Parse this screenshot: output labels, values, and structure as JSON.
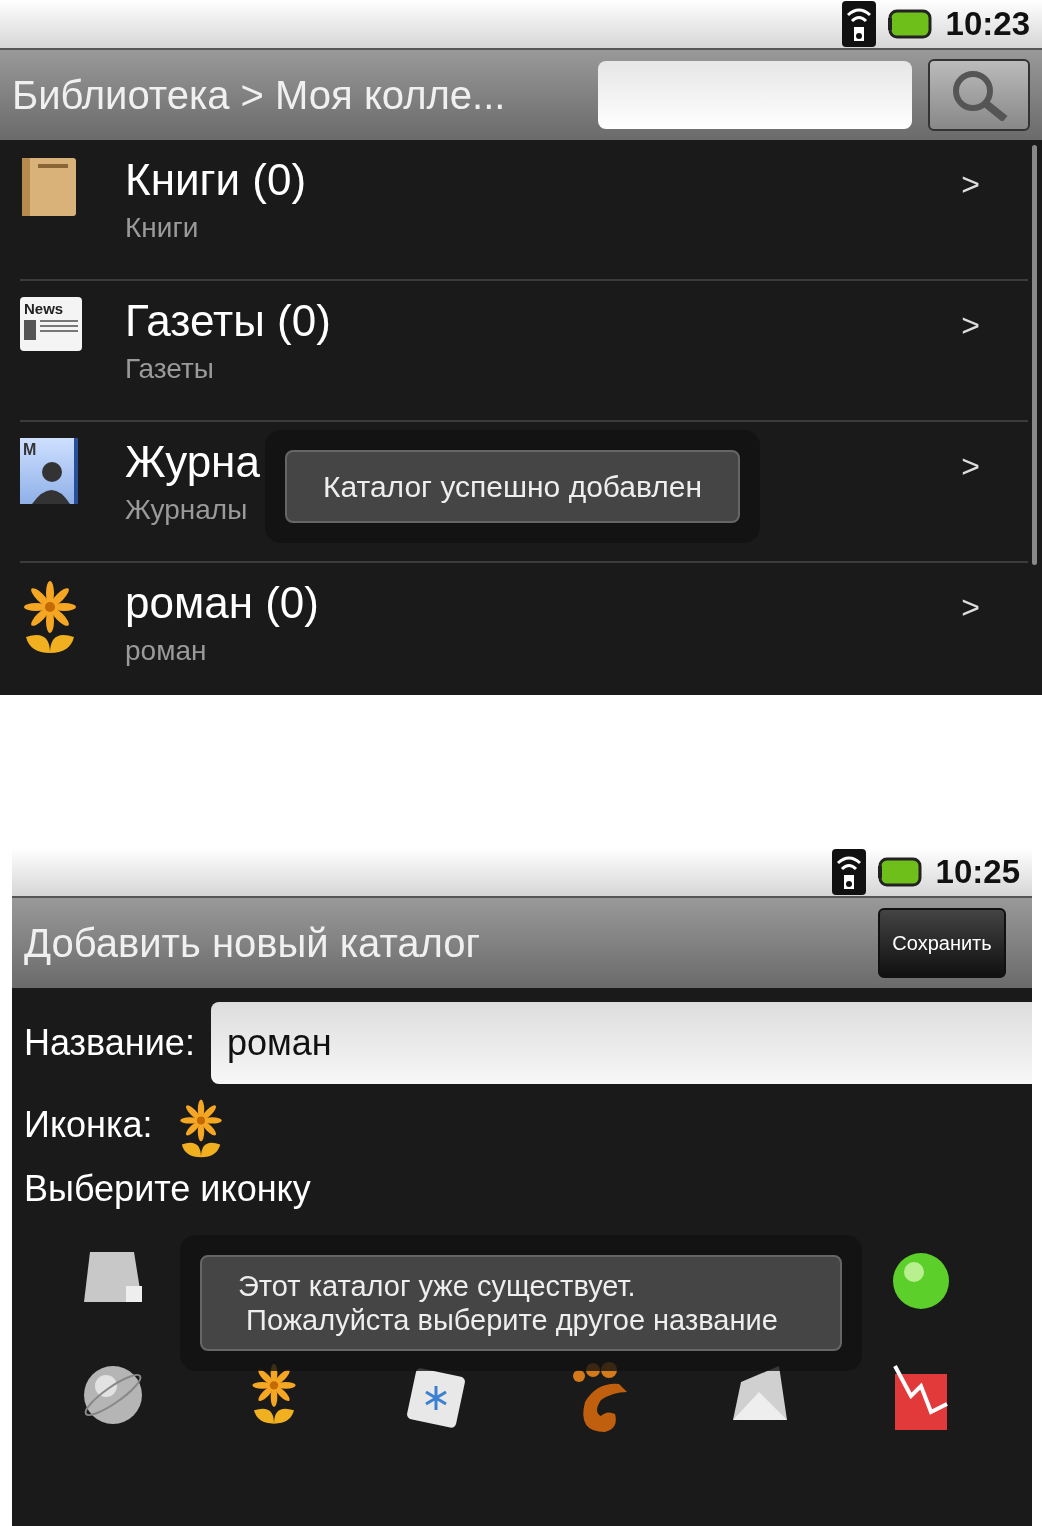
{
  "library_screen": {
    "status_bar": {
      "time": "10:23"
    },
    "title": "Библиотека > Моя колле...",
    "catalogs": [
      {
        "kind": "book",
        "title": "Книги (0)",
        "subtitle": "Книги",
        "chevron": ">"
      },
      {
        "kind": "news",
        "badge": "News",
        "title": "Газеты (0)",
        "subtitle": "Газеты",
        "chevron": ">"
      },
      {
        "kind": "magazine",
        "badge": "M",
        "title": "Журна",
        "subtitle": "Журналы",
        "chevron": ">"
      },
      {
        "kind": "flower",
        "title": "роман (0)",
        "subtitle": "роман",
        "chevron": ">"
      }
    ],
    "toast": "Каталог успешно добавлен"
  },
  "add_catalog_screen": {
    "status_bar": {
      "time": "10:25"
    },
    "title": "Добавить новый каталог",
    "save_button": "Сохранить",
    "name_label": "Название:",
    "name_value": "роман",
    "icon_label": "Иконка:",
    "choose_label": "Выберите иконку",
    "toast": "Этот каталог уже существует.\n Пожалуйста выберите другое название"
  }
}
